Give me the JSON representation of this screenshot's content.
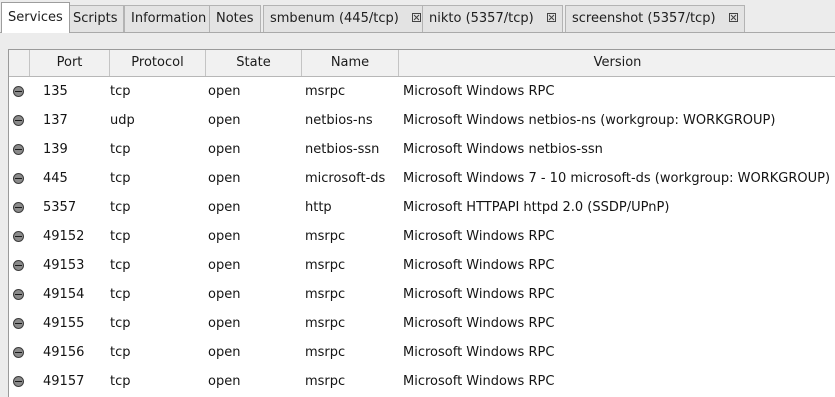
{
  "tabs": [
    {
      "label": "Services",
      "closable": false,
      "active": true
    },
    {
      "label": "Scripts",
      "closable": false,
      "active": false
    },
    {
      "label": "Information",
      "closable": false,
      "active": false
    },
    {
      "label": "Notes",
      "closable": false,
      "active": false
    },
    {
      "label": "smbenum (445/tcp)",
      "closable": true,
      "active": false
    },
    {
      "label": "nikto (5357/tcp)",
      "closable": true,
      "active": false
    },
    {
      "label": "screenshot (5357/tcp)",
      "closable": true,
      "active": false
    }
  ],
  "table": {
    "columns": {
      "port": "Port",
      "protocol": "Protocol",
      "state": "State",
      "name": "Name",
      "version": "Version"
    },
    "rows": [
      {
        "port": "135",
        "protocol": "tcp",
        "state": "open",
        "name": "msrpc",
        "version": "Microsoft Windows RPC"
      },
      {
        "port": "137",
        "protocol": "udp",
        "state": "open",
        "name": "netbios-ns",
        "version": "Microsoft Windows netbios-ns (workgroup: WORKGROUP)"
      },
      {
        "port": "139",
        "protocol": "tcp",
        "state": "open",
        "name": "netbios-ssn",
        "version": "Microsoft Windows netbios-ssn"
      },
      {
        "port": "445",
        "protocol": "tcp",
        "state": "open",
        "name": "microsoft-ds",
        "version": "Microsoft Windows 7 - 10 microsoft-ds (workgroup: WORKGROUP)"
      },
      {
        "port": "5357",
        "protocol": "tcp",
        "state": "open",
        "name": "http",
        "version": "Microsoft HTTPAPI httpd 2.0 (SSDP/UPnP)"
      },
      {
        "port": "49152",
        "protocol": "tcp",
        "state": "open",
        "name": "msrpc",
        "version": "Microsoft Windows RPC"
      },
      {
        "port": "49153",
        "protocol": "tcp",
        "state": "open",
        "name": "msrpc",
        "version": "Microsoft Windows RPC"
      },
      {
        "port": "49154",
        "protocol": "tcp",
        "state": "open",
        "name": "msrpc",
        "version": "Microsoft Windows RPC"
      },
      {
        "port": "49155",
        "protocol": "tcp",
        "state": "open",
        "name": "msrpc",
        "version": "Microsoft Windows RPC"
      },
      {
        "port": "49156",
        "protocol": "tcp",
        "state": "open",
        "name": "msrpc",
        "version": "Microsoft Windows RPC"
      },
      {
        "port": "49157",
        "protocol": "tcp",
        "state": "open",
        "name": "msrpc",
        "version": "Microsoft Windows RPC"
      }
    ]
  }
}
